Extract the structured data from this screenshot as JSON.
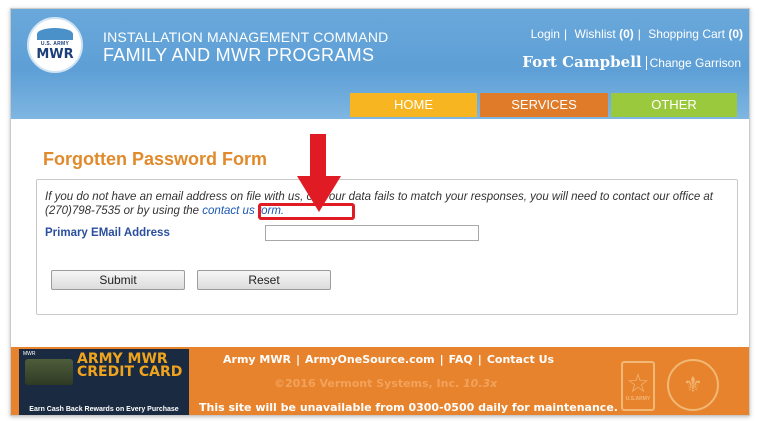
{
  "header": {
    "logo": {
      "small": "U.S. ARMY",
      "big": "MWR"
    },
    "org_line1": "INSTALLATION MANAGEMENT COMMAND",
    "org_line2": "FAMILY AND MWR PROGRAMS",
    "top_links": {
      "login": "Login",
      "wishlist": "Wishlist",
      "wishlist_count": "(0)",
      "cart": "Shopping Cart",
      "cart_count": "(0)"
    },
    "garrison": {
      "name": "Fort Campbell",
      "change": "Change Garrison"
    }
  },
  "nav": {
    "home": "HOME",
    "services": "SERVICES",
    "other": "OTHER"
  },
  "form": {
    "title": "Forgotten Password Form",
    "info_text": "If you do not have an email address on file with us, or if our data fails to match your responses, you will need to contact our office at (270)798-7535 or by using the",
    "link_text": "contact us form.",
    "email_label": "Primary EMail Address",
    "email_value": "",
    "submit_label": "Submit",
    "reset_label": "Reset"
  },
  "footer": {
    "banner_logo": "MWR",
    "banner_title_1": "ARMY MWR",
    "banner_title_2": "CREDIT CARD",
    "banner_sub": "Earn Cash Back Rewards on Every Purchase",
    "links": [
      "Army MWR",
      "ArmyOneSource.com",
      "FAQ",
      "Contact Us"
    ],
    "copyright": "©2016 Vermont Systems, Inc.",
    "version": "10.3x",
    "notice": "This site will be unavailable from 0300-0500 daily for maintenance.",
    "badge_label": "U.S.ARMY"
  },
  "colors": {
    "header_blue": "#5d9fd6",
    "home_tab": "#f7b521",
    "services_tab": "#e07b2a",
    "other_tab": "#9bc93d",
    "title_orange": "#e08a2c",
    "footer_orange": "#e8832d",
    "annotation_red": "#e01b24"
  }
}
